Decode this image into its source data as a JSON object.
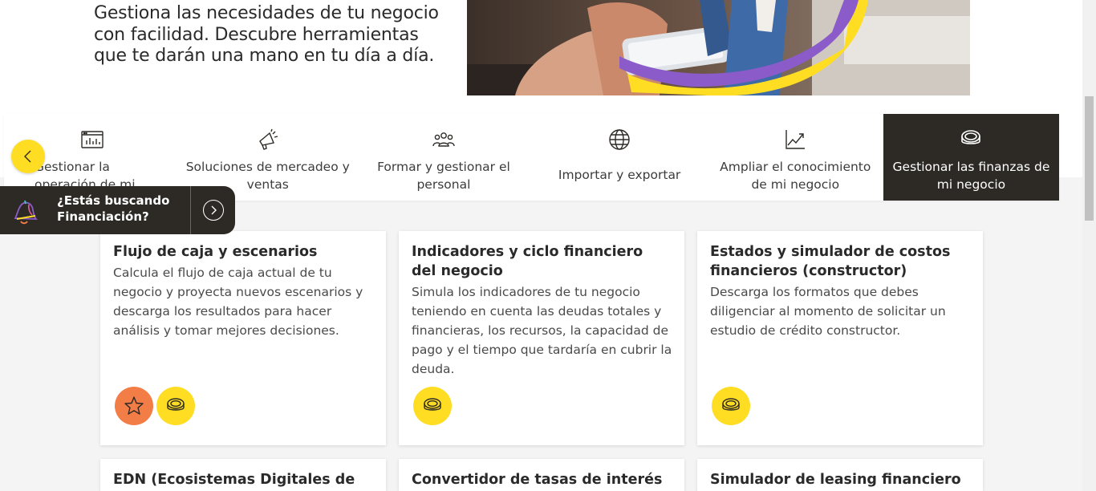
{
  "hero": {
    "text": "Gestiona las necesidades de tu negocio con facilidad. Descubre herramientas que te darán una mano en tu día a día."
  },
  "tabs": [
    {
      "label": "Gestionar la operación de mi negocio",
      "icon": "dashboard-icon",
      "active": false
    },
    {
      "label": "Soluciones de mercadeo y ventas",
      "icon": "megaphone-icon",
      "active": false
    },
    {
      "label": "Formar y gestionar el personal",
      "icon": "people-icon",
      "active": false
    },
    {
      "label": "Importar y exportar",
      "icon": "globe-icon",
      "active": false
    },
    {
      "label": "Ampliar el conocimiento de mi negocio",
      "icon": "growth-chart-icon",
      "active": false
    },
    {
      "label": "Gestionar las finanzas de mi negocio",
      "icon": "coins-icon",
      "active": true
    }
  ],
  "financing_banner": {
    "label": "¿Estás buscando Financiación?"
  },
  "cards": [
    {
      "title": "Flujo de caja y escenarios",
      "description": "Calcula el flujo de caja actual de tu negocio y proyecta nuevos escenarios y descarga los resultados para hacer análisis y tomar mejores decisiones.",
      "badges": [
        "star-icon",
        "coins-icon"
      ]
    },
    {
      "title": "Indicadores y ciclo financiero del negocio",
      "description": "Simula los indicadores de tu negocio teniendo en cuenta las deudas totales y financieras, los recursos, la capacidad de pago y el tiempo que tardaría en cubrir la deuda.",
      "badges": [
        "coins-icon"
      ]
    },
    {
      "title": "Estados y simulador de costos financieros (constructor)",
      "description": "Descarga los formatos que debes diligenciar al momento de solicitar un estudio de crédito constructor.",
      "badges": [
        "coins-icon"
      ]
    },
    {
      "title": "EDN (Ecosistemas Digitales de",
      "description": "",
      "badges": []
    },
    {
      "title": "Convertidor de tasas de interés",
      "description": "",
      "badges": []
    },
    {
      "title": "Simulador de leasing financiero",
      "description": "",
      "badges": []
    }
  ],
  "colors": {
    "accent_yellow": "#fedd23",
    "accent_orange": "#f27d47",
    "dark": "#2d2a26"
  }
}
